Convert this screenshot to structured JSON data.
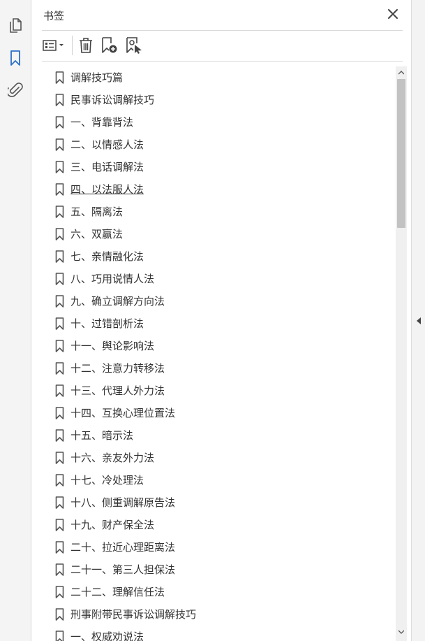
{
  "panel": {
    "title": "书签"
  },
  "left_rail": {
    "icons": [
      "pages-icon",
      "bookmarks-icon",
      "attachments-icon"
    ],
    "active_color": "#2a6fc7"
  },
  "toolbar": {
    "icons": [
      "options-menu-icon",
      "delete-icon",
      "new-bookmark-icon",
      "bookmark-from-selection-icon"
    ]
  },
  "bookmarks": [
    {
      "label": "调解技巧篇"
    },
    {
      "label": "民事诉讼调解技巧"
    },
    {
      "label": "一、背靠背法"
    },
    {
      "label": "二、以情感人法"
    },
    {
      "label": "三、电话调解法"
    },
    {
      "label": "四、以法服人法",
      "underlined": true
    },
    {
      "label": "五、隔离法"
    },
    {
      "label": "六、双赢法"
    },
    {
      "label": "七、亲情融化法"
    },
    {
      "label": "八、巧用说情人法"
    },
    {
      "label": "九、确立调解方向法"
    },
    {
      "label": "十、过错剖析法"
    },
    {
      "label": "十一、舆论影响法"
    },
    {
      "label": "十二、注意力转移法"
    },
    {
      "label": "十三、代理人外力法"
    },
    {
      "label": "十四、互换心理位置法"
    },
    {
      "label": "十五、暗示法"
    },
    {
      "label": "十六、亲友外力法"
    },
    {
      "label": "十七、冷处理法"
    },
    {
      "label": "十八、侧重调解原告法"
    },
    {
      "label": "十九、财产保全法"
    },
    {
      "label": "二十、拉近心理距离法"
    },
    {
      "label": "二十一、第三人担保法"
    },
    {
      "label": "二十二、理解信任法"
    },
    {
      "label": "刑事附带民事诉讼调解技巧"
    },
    {
      "label": "一、权威劝说法"
    }
  ]
}
